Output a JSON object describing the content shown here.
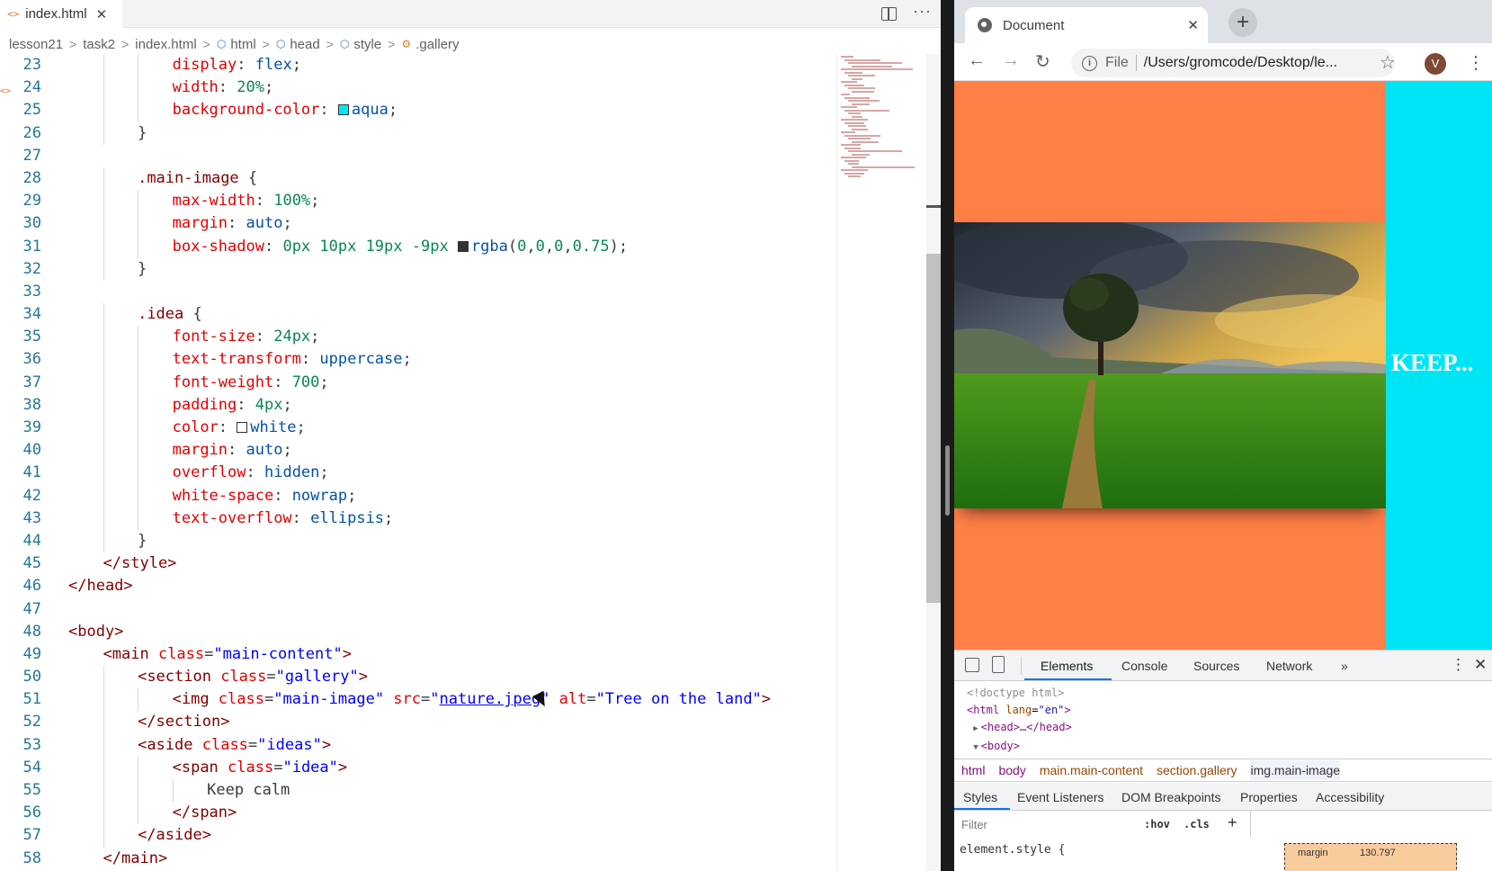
{
  "editor": {
    "tab": {
      "label": "index.html",
      "icon": "html-file-icon"
    },
    "breadcrumb": [
      {
        "label": "lesson21",
        "icon": ""
      },
      {
        "label": "task2",
        "icon": ""
      },
      {
        "label": "index.html",
        "icon": "html-file-icon"
      },
      {
        "label": "html",
        "icon": "element-icon"
      },
      {
        "label": "head",
        "icon": "element-icon"
      },
      {
        "label": "style",
        "icon": "element-icon"
      },
      {
        "label": ".gallery",
        "icon": "selector-icon"
      }
    ],
    "lines": [
      {
        "num": "23",
        "indent": 3,
        "tokens": [
          [
            "prop",
            "display"
          ],
          [
            "punc",
            ": "
          ],
          [
            "val",
            "flex"
          ],
          [
            "punc",
            ";"
          ]
        ]
      },
      {
        "num": "24",
        "indent": 3,
        "tokens": [
          [
            "prop",
            "width"
          ],
          [
            "punc",
            ": "
          ],
          [
            "num",
            "20%"
          ],
          [
            "punc",
            ";"
          ]
        ]
      },
      {
        "num": "25",
        "indent": 3,
        "tokens": [
          [
            "prop",
            "background-color"
          ],
          [
            "punc",
            ": "
          ],
          [
            "swatch",
            "#00e5f5"
          ],
          [
            "val",
            "aqua"
          ],
          [
            "punc",
            ";"
          ]
        ]
      },
      {
        "num": "26",
        "indent": 2,
        "tokens": [
          [
            "punc",
            "}"
          ]
        ]
      },
      {
        "num": "27",
        "indent": 0,
        "tokens": []
      },
      {
        "num": "28",
        "indent": 2,
        "tokens": [
          [
            "sel",
            ".main-image"
          ],
          [
            "punc",
            " {"
          ]
        ]
      },
      {
        "num": "29",
        "indent": 3,
        "tokens": [
          [
            "prop",
            "max-width"
          ],
          [
            "punc",
            ": "
          ],
          [
            "num",
            "100%"
          ],
          [
            "punc",
            ";"
          ]
        ]
      },
      {
        "num": "30",
        "indent": 3,
        "tokens": [
          [
            "prop",
            "margin"
          ],
          [
            "punc",
            ": "
          ],
          [
            "val",
            "auto"
          ],
          [
            "punc",
            ";"
          ]
        ]
      },
      {
        "num": "31",
        "indent": 3,
        "tokens": [
          [
            "prop",
            "box-shadow"
          ],
          [
            "punc",
            ": "
          ],
          [
            "num",
            "0px 10px 19px -9px "
          ],
          [
            "swatch",
            "#333333"
          ],
          [
            "val",
            "rgba"
          ],
          [
            "punc",
            "("
          ],
          [
            "num",
            "0"
          ],
          [
            "punc",
            ","
          ],
          [
            "num",
            "0"
          ],
          [
            "punc",
            ","
          ],
          [
            "num",
            "0"
          ],
          [
            "punc",
            ","
          ],
          [
            "num",
            "0.75"
          ],
          [
            "punc",
            ");"
          ]
        ]
      },
      {
        "num": "32",
        "indent": 2,
        "tokens": [
          [
            "punc",
            "}"
          ]
        ]
      },
      {
        "num": "33",
        "indent": 0,
        "tokens": []
      },
      {
        "num": "34",
        "indent": 2,
        "tokens": [
          [
            "sel",
            ".idea"
          ],
          [
            "punc",
            " {"
          ]
        ]
      },
      {
        "num": "35",
        "indent": 3,
        "tokens": [
          [
            "prop",
            "font-size"
          ],
          [
            "punc",
            ": "
          ],
          [
            "num",
            "24px"
          ],
          [
            "punc",
            ";"
          ]
        ]
      },
      {
        "num": "36",
        "indent": 3,
        "tokens": [
          [
            "prop",
            "text-transform"
          ],
          [
            "punc",
            ": "
          ],
          [
            "val",
            "uppercase"
          ],
          [
            "punc",
            ";"
          ]
        ]
      },
      {
        "num": "37",
        "indent": 3,
        "tokens": [
          [
            "prop",
            "font-weight"
          ],
          [
            "punc",
            ": "
          ],
          [
            "num",
            "700"
          ],
          [
            "punc",
            ";"
          ]
        ]
      },
      {
        "num": "38",
        "indent": 3,
        "tokens": [
          [
            "prop",
            "padding"
          ],
          [
            "punc",
            ": "
          ],
          [
            "num",
            "4px"
          ],
          [
            "punc",
            ";"
          ]
        ]
      },
      {
        "num": "39",
        "indent": 3,
        "tokens": [
          [
            "prop",
            "color"
          ],
          [
            "punc",
            ": "
          ],
          [
            "swatch",
            "#ffffff"
          ],
          [
            "val",
            "white"
          ],
          [
            "punc",
            ";"
          ]
        ]
      },
      {
        "num": "40",
        "indent": 3,
        "tokens": [
          [
            "prop",
            "margin"
          ],
          [
            "punc",
            ": "
          ],
          [
            "val",
            "auto"
          ],
          [
            "punc",
            ";"
          ]
        ]
      },
      {
        "num": "41",
        "indent": 3,
        "tokens": [
          [
            "prop",
            "overflow"
          ],
          [
            "punc",
            ": "
          ],
          [
            "val",
            "hidden"
          ],
          [
            "punc",
            ";"
          ]
        ]
      },
      {
        "num": "42",
        "indent": 3,
        "tokens": [
          [
            "prop",
            "white-space"
          ],
          [
            "punc",
            ": "
          ],
          [
            "val",
            "nowrap"
          ],
          [
            "punc",
            ";"
          ]
        ]
      },
      {
        "num": "43",
        "indent": 3,
        "tokens": [
          [
            "prop",
            "text-overflow"
          ],
          [
            "punc",
            ": "
          ],
          [
            "val",
            "ellipsis"
          ],
          [
            "punc",
            ";"
          ]
        ]
      },
      {
        "num": "44",
        "indent": 2,
        "tokens": [
          [
            "punc",
            "}"
          ]
        ]
      },
      {
        "num": "45",
        "indent": 1,
        "tokens": [
          [
            "tag",
            "</style>"
          ]
        ]
      },
      {
        "num": "46",
        "indent": 0,
        "tokens": [
          [
            "tag",
            "</head>"
          ]
        ]
      },
      {
        "num": "47",
        "indent": 0,
        "tokens": []
      },
      {
        "num": "48",
        "indent": 0,
        "tokens": [
          [
            "tag",
            "<body>"
          ]
        ]
      },
      {
        "num": "49",
        "indent": 1,
        "tokens": [
          [
            "tag",
            "<main "
          ],
          [
            "attr",
            "class"
          ],
          [
            "punc",
            "="
          ],
          [
            "str",
            "\"main-content\""
          ],
          [
            "tag",
            ">"
          ]
        ]
      },
      {
        "num": "50",
        "indent": 2,
        "tokens": [
          [
            "tag",
            "<section "
          ],
          [
            "attr",
            "class"
          ],
          [
            "punc",
            "="
          ],
          [
            "str",
            "\"gallery\""
          ],
          [
            "tag",
            ">"
          ]
        ]
      },
      {
        "num": "51",
        "indent": 3,
        "tokens": [
          [
            "tag",
            "<img "
          ],
          [
            "attr",
            "class"
          ],
          [
            "punc",
            "="
          ],
          [
            "str",
            "\"main-image\" "
          ],
          [
            "attr",
            "src"
          ],
          [
            "punc",
            "="
          ],
          [
            "str",
            "\""
          ],
          [
            "link",
            "nature.jpeg"
          ],
          [
            "str",
            "\" "
          ],
          [
            "attr",
            "alt"
          ],
          [
            "punc",
            "="
          ],
          [
            "str",
            "\"Tree on the land\""
          ],
          [
            "tag",
            ">"
          ]
        ]
      },
      {
        "num": "52",
        "indent": 2,
        "tokens": [
          [
            "tag",
            "</section>"
          ]
        ]
      },
      {
        "num": "53",
        "indent": 2,
        "tokens": [
          [
            "tag",
            "<aside "
          ],
          [
            "attr",
            "class"
          ],
          [
            "punc",
            "="
          ],
          [
            "str",
            "\"ideas\""
          ],
          [
            "tag",
            ">"
          ]
        ]
      },
      {
        "num": "54",
        "indent": 3,
        "tokens": [
          [
            "tag",
            "<span "
          ],
          [
            "attr",
            "class"
          ],
          [
            "punc",
            "="
          ],
          [
            "str",
            "\"idea\""
          ],
          [
            "tag",
            ">"
          ]
        ]
      },
      {
        "num": "55",
        "indent": 4,
        "tokens": [
          [
            "punc",
            "Keep calm"
          ]
        ]
      },
      {
        "num": "56",
        "indent": 3,
        "tokens": [
          [
            "tag",
            "</span>"
          ]
        ]
      },
      {
        "num": "57",
        "indent": 2,
        "tokens": [
          [
            "tag",
            "</aside>"
          ]
        ]
      },
      {
        "num": "58",
        "indent": 1,
        "tokens": [
          [
            "tag",
            "</main>"
          ]
        ]
      }
    ]
  },
  "browser": {
    "tab_title": "Document",
    "tab_icon": "globe-icon",
    "omnibox": {
      "scheme_label": "File",
      "url": "/Users/gromcode/Desktop/le..."
    },
    "profile_initial": "V",
    "page": {
      "image_alt": "Tree on the land",
      "idea_text": "KEEP...",
      "colors": {
        "page_bg": "#ff7f47",
        "aside_bg": "#00e5f5",
        "idea_text": "#ffffff"
      }
    },
    "devtools": {
      "tabs": [
        "Elements",
        "Console",
        "Sources",
        "Network",
        "»"
      ],
      "active_tab": "Elements",
      "dom": {
        "doctype": "<!doctype html>",
        "html_open": "<html",
        "html_lang_attr": "lang",
        "html_lang_val": "\"en\"",
        "head_collapsed": "<head>…</head>",
        "body_open": "<body>"
      },
      "crumbs": [
        "html",
        "body",
        "main.main-content",
        "section.gallery",
        "img.main-image"
      ],
      "sub_tabs": [
        "Styles",
        "Event Listeners",
        "DOM Breakpoints",
        "Properties",
        "Accessibility"
      ],
      "filter_placeholder": "Filter",
      "hov_label": ":hov",
      "cls_label": ".cls",
      "element_style": "element.style {",
      "box_model": {
        "label": "margin",
        "value": "130.797"
      }
    }
  }
}
